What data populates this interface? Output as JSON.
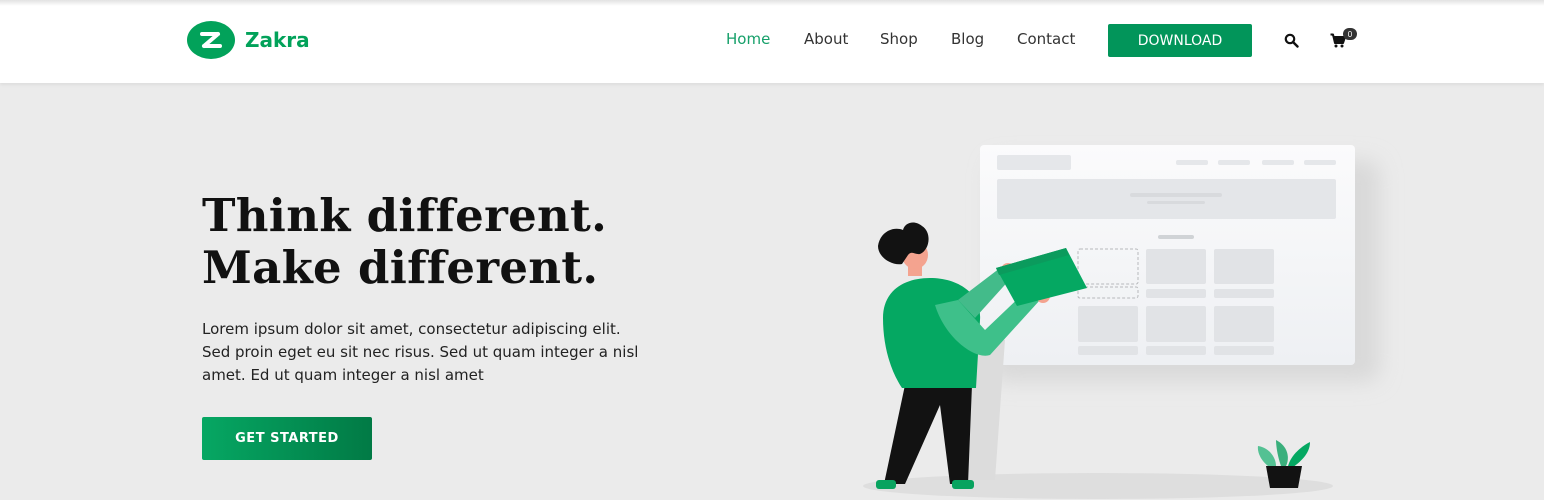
{
  "brand": {
    "name": "Zakra",
    "color": "#02a25a",
    "logo_icon": "zakra-logo-icon"
  },
  "nav": {
    "items": [
      {
        "label": "Home",
        "active": true
      },
      {
        "label": "About",
        "active": false
      },
      {
        "label": "Shop",
        "active": false
      },
      {
        "label": "Blog",
        "active": false
      },
      {
        "label": "Contact",
        "active": false
      }
    ],
    "download_label": "DOWNLOAD",
    "search_icon": "search-icon",
    "cart_icon": "cart-icon",
    "cart_count": "0"
  },
  "hero": {
    "title_line1": "Think different.",
    "title_line2": "Make different.",
    "text_line1": "Lorem ipsum dolor sit amet, consectetur adipiscing elit.",
    "text_line2": "Sed proin eget eu sit nec risus. Sed ut quam integer a nisl",
    "text_line3": "amet.  Ed ut quam integer a nisl amet",
    "cta_label": "GET STARTED"
  },
  "colors": {
    "accent": "#02a25a",
    "accent_dark": "#017a45",
    "background": "#ebebeb"
  },
  "illustration": {
    "subject": "person-placing-card-on-website-wireframe",
    "plant": "potted-plant"
  }
}
